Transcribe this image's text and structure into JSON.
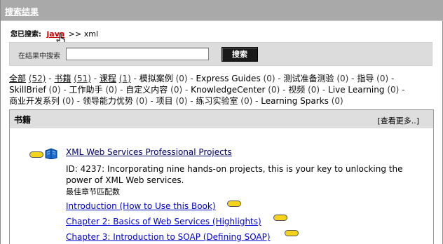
{
  "header": {
    "title": "搜索结果"
  },
  "breadcrumb": {
    "prefix": "您已搜索:",
    "link": "java",
    "rest": ">> xml"
  },
  "search": {
    "label": "在结果中搜索",
    "value": "",
    "placeholder": "",
    "button": "搜索"
  },
  "filters": [
    {
      "label": "全部",
      "count": "(52)",
      "active": true
    },
    {
      "label": "书籍",
      "count": "(51)",
      "active": true
    },
    {
      "label": "课程",
      "count": "(1)",
      "active": true
    },
    {
      "label": "模拟案例",
      "count": "(0)"
    },
    {
      "label": "Express Guides",
      "count": "(0)"
    },
    {
      "label": "测试准备测验",
      "count": "(0)"
    },
    {
      "label": "指导",
      "count": "(0)"
    },
    {
      "label": "SkillBrief",
      "count": "(0)"
    },
    {
      "label": "工作助手",
      "count": "(0)"
    },
    {
      "label": "自定义内容",
      "count": "(0)"
    },
    {
      "label": "KnowledgeCenter",
      "count": "(0)"
    },
    {
      "label": "视频",
      "count": "(0)"
    },
    {
      "label": "Live Learning",
      "count": "(0)"
    },
    {
      "label": "商业开发系列",
      "count": "(0)"
    },
    {
      "label": "领导能力优势",
      "count": "(0)"
    },
    {
      "label": "项目",
      "count": "(0)"
    },
    {
      "label": "练习实验室",
      "count": "(0)"
    },
    {
      "label": "Learning Sparks",
      "count": "(0)"
    }
  ],
  "section": {
    "title": "书籍",
    "see_more": "[查看更多..]"
  },
  "book": {
    "title": "XML Web Services Professional Projects",
    "description": "ID:   4237: Incorporating nine hands-on projects, this is your key to unlocking the power of XML Web services.",
    "best_chapters_label": "最佳章节匹配数",
    "chapters": [
      "Introduction (How to Use this Book)",
      "Chapter 2: Basics of Web Services (Highlights)",
      "Chapter 3: Introduction to SOAP (Defining SOAP)"
    ]
  },
  "colors": {
    "header_bg": "#a9a9a9",
    "badge": "#f3d31b",
    "link_red": "#cc0000",
    "chapter_link": "#0000cc"
  },
  "icons": {
    "book": "book-icon",
    "badge": "relevance-badge-icon",
    "cursor": "hand-cursor-icon"
  }
}
